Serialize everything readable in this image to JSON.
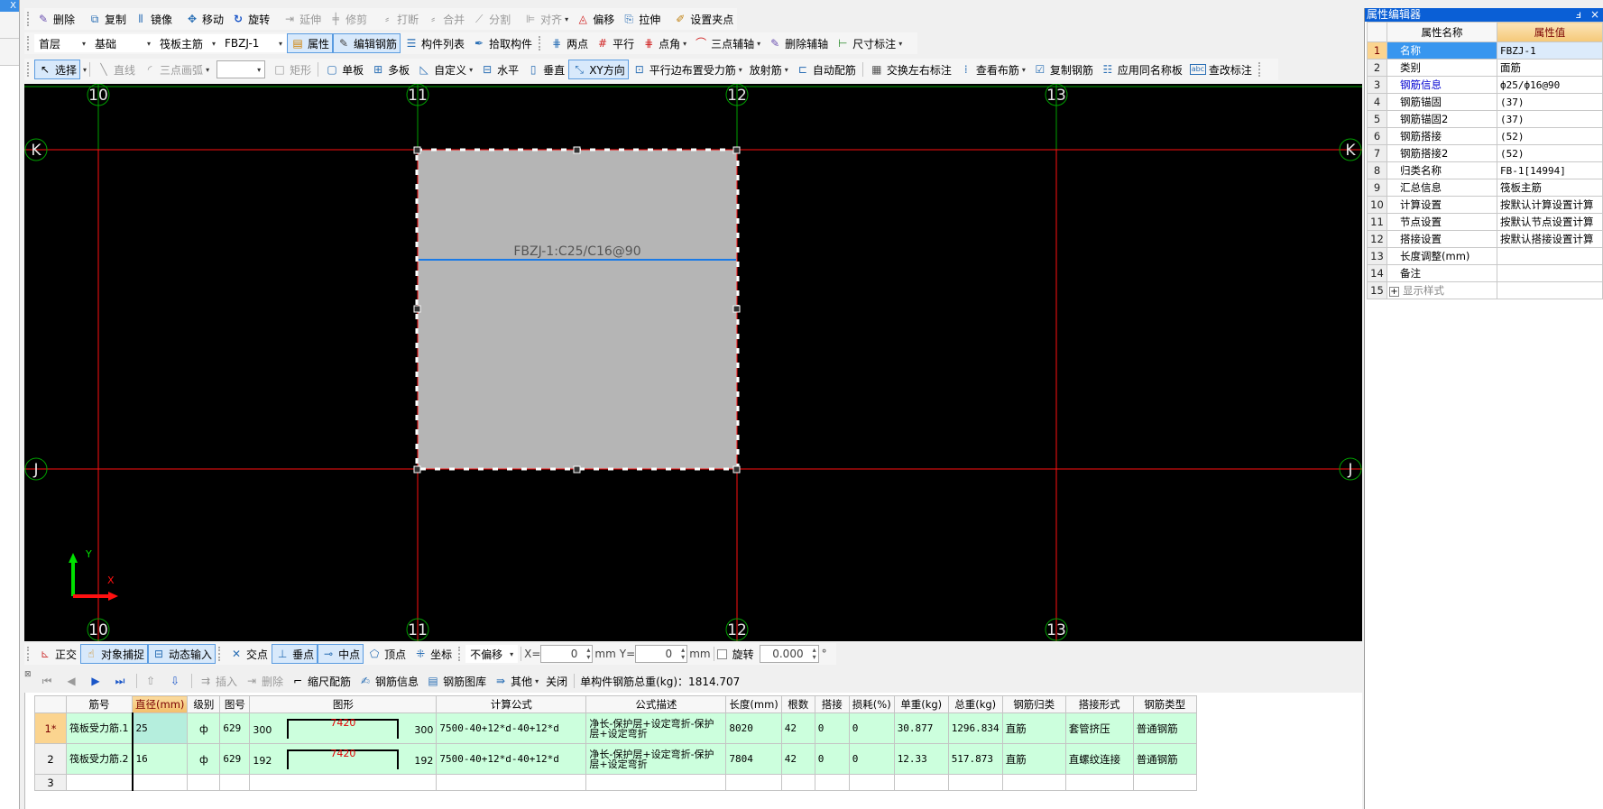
{
  "left_panel": {
    "close_label": "X"
  },
  "toolbar1": {
    "items": [
      {
        "icon": "eraser-icon",
        "label": "删除"
      },
      {
        "icon": "copy-icon",
        "label": "复制"
      },
      {
        "icon": "mirror-icon",
        "label": "镜像"
      },
      {
        "icon": "move-icon",
        "label": "移动"
      },
      {
        "icon": "rotate-icon",
        "label": "旋转"
      },
      {
        "icon": "extend-icon",
        "label": "延伸"
      },
      {
        "icon": "trim-icon",
        "label": "修剪"
      },
      {
        "icon": "break-icon",
        "label": "打断"
      },
      {
        "icon": "merge-icon",
        "label": "合并"
      },
      {
        "icon": "split-icon",
        "label": "分割"
      },
      {
        "icon": "align-icon",
        "label": "对齐"
      },
      {
        "icon": "offset-icon",
        "label": "偏移"
      },
      {
        "icon": "stretch-icon",
        "label": "拉伸"
      },
      {
        "icon": "grip-point-icon",
        "label": "设置夹点"
      }
    ]
  },
  "toolbar2": {
    "floor": "首层",
    "category": "基础",
    "type": "筏板主筋",
    "component": "FBZJ-1",
    "items": [
      {
        "icon": "properties-icon",
        "label": "属性"
      },
      {
        "icon": "edit-rebar-icon",
        "label": "编辑钢筋"
      },
      {
        "icon": "list-icon",
        "label": "构件列表"
      },
      {
        "icon": "eyedropper-icon",
        "label": "拾取构件"
      },
      {
        "icon": "two-point-axis-icon",
        "label": "两点"
      },
      {
        "icon": "parallel-axis-icon",
        "label": "平行"
      },
      {
        "icon": "point-angle-icon",
        "label": "点角"
      },
      {
        "icon": "three-point-axis-icon",
        "label": "三点辅轴"
      },
      {
        "icon": "delete-axis-icon",
        "label": "删除辅轴"
      },
      {
        "icon": "dimension-icon",
        "label": "尺寸标注"
      }
    ]
  },
  "toolbar3": {
    "select_label": "选择",
    "line_label": "直线",
    "arc_label": "三点画弧",
    "rect_label": "矩形",
    "items": [
      {
        "icon": "single-slab-icon",
        "label": "单板"
      },
      {
        "icon": "multi-slab-icon",
        "label": "多板"
      },
      {
        "icon": "custom-icon",
        "label": "自定义"
      },
      {
        "icon": "horizontal-icon",
        "label": "水平"
      },
      {
        "icon": "vertical-icon",
        "label": "垂直"
      },
      {
        "icon": "xy-direction-icon",
        "label": "XY方向"
      },
      {
        "icon": "parallel-edge-icon",
        "label": "平行边布置受力筋"
      },
      {
        "icon": "radial-icon",
        "label": "放射筋"
      },
      {
        "icon": "auto-rebar-icon",
        "label": "自动配筋"
      },
      {
        "icon": "swap-label-icon",
        "label": "交换左右标注"
      },
      {
        "icon": "view-layout-icon",
        "label": "查看布筋"
      },
      {
        "icon": "copy-rebar-icon",
        "label": "复制钢筋"
      },
      {
        "icon": "apply-same-icon",
        "label": "应用同名称板"
      },
      {
        "icon": "edit-label-icon",
        "label": "查改标注"
      }
    ]
  },
  "canvas": {
    "vertical_axes": [
      "10",
      "11",
      "12",
      "13"
    ],
    "horizontal_axes": [
      "K",
      "J"
    ],
    "slab_label": "FBZJ-1:C25/C16@90",
    "ucs_x": "X",
    "ucs_y": "Y"
  },
  "snapbar": {
    "ortho": "正交",
    "object_snap": "对象捕捉",
    "dynamic_input": "动态输入",
    "intersection": "交点",
    "perpendicular": "垂点",
    "midpoint": "中点",
    "vertex": "顶点",
    "coordinate": "坐标",
    "offset_mode": "不偏移",
    "x_label": "X=",
    "x_value": "0",
    "y_label": "Y=",
    "y_value": "0",
    "unit": "mm",
    "rotate_label": "旋转",
    "rotate_value": "0.000",
    "degree": "°"
  },
  "gridbar": {
    "insert": "插入",
    "delete": "删除",
    "scale_rebar": "缩尺配筋",
    "rebar_info": "钢筋信息",
    "rebar_library": "钢筋图库",
    "other": "其他",
    "close": "关闭",
    "total_weight": "单构件钢筋总重(kg)：1814.707"
  },
  "rebar_table": {
    "columns": [
      "",
      "筋号",
      "直径(mm)",
      "级别",
      "图号",
      "图形",
      "计算公式",
      "公式描述",
      "长度(mm)",
      "根数",
      "搭接",
      "损耗(%)",
      "单重(kg)",
      "总重(kg)",
      "钢筋归类",
      "搭接形式",
      "钢筋类型"
    ],
    "rows": [
      {
        "no": "1*",
        "name": "筏板受力筋.1",
        "diameter": "25",
        "grade": "ф",
        "fig": "629",
        "shape_left": "300",
        "shape_mid": "7420",
        "shape_right": "300",
        "formula": "7500-40+12*d-40+12*d",
        "desc": "净长-保护层+设定弯折-保护层+设定弯折",
        "length": "8020",
        "count": "42",
        "lap": "0",
        "loss": "0",
        "unit_wt": "30.877",
        "total_wt": "1296.834",
        "class": "直筋",
        "lap_type": "套管挤压",
        "rebar_type": "普通钢筋"
      },
      {
        "no": "2",
        "name": "筏板受力筋.2",
        "diameter": "16",
        "grade": "ф",
        "fig": "629",
        "shape_left": "192",
        "shape_mid": "7420",
        "shape_right": "192",
        "formula": "7500-40+12*d-40+12*d",
        "desc": "净长-保护层+设定弯折-保护层+设定弯折",
        "length": "7804",
        "count": "42",
        "lap": "0",
        "loss": "0",
        "unit_wt": "12.33",
        "total_wt": "517.873",
        "class": "直筋",
        "lap_type": "直螺纹连接",
        "rebar_type": "普通钢筋"
      }
    ],
    "empty_row_no": "3"
  },
  "property_editor": {
    "title": "属性编辑器",
    "pin": "ⅎ",
    "close": "×",
    "header_name": "属性名称",
    "header_value": "属性值",
    "rows": [
      {
        "no": "1",
        "name": "名称",
        "value": "FBZJ-1"
      },
      {
        "no": "2",
        "name": "类别",
        "value": "面筋"
      },
      {
        "no": "3",
        "name": "钢筋信息",
        "value": "ф25/ф16@90"
      },
      {
        "no": "4",
        "name": "钢筋锚固",
        "value": "(37)"
      },
      {
        "no": "5",
        "name": "钢筋锚固2",
        "value": "(37)"
      },
      {
        "no": "6",
        "name": "钢筋搭接",
        "value": "(52)"
      },
      {
        "no": "7",
        "name": "钢筋搭接2",
        "value": "(52)"
      },
      {
        "no": "8",
        "name": "归类名称",
        "value": "FB-1[14994]"
      },
      {
        "no": "9",
        "name": "汇总信息",
        "value": "筏板主筋"
      },
      {
        "no": "10",
        "name": "计算设置",
        "value": "按默认计算设置计算"
      },
      {
        "no": "11",
        "name": "节点设置",
        "value": "按默认节点设置计算"
      },
      {
        "no": "12",
        "name": "搭接设置",
        "value": "按默认搭接设置计算"
      },
      {
        "no": "13",
        "name": "长度调整(mm)",
        "value": ""
      },
      {
        "no": "14",
        "name": "备注",
        "value": ""
      },
      {
        "no": "15",
        "name": "显示样式",
        "value": ""
      }
    ]
  }
}
